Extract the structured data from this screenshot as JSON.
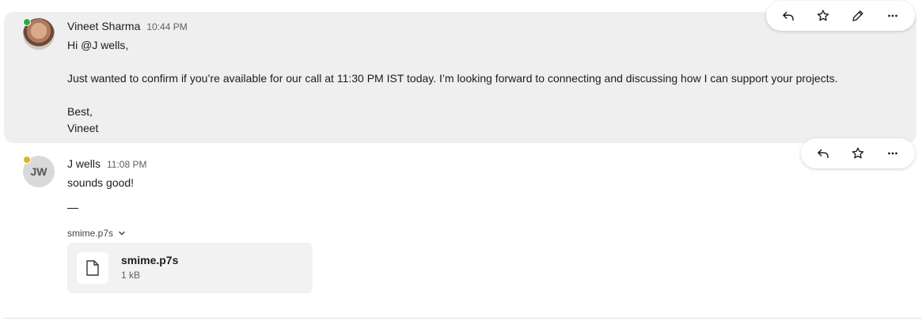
{
  "messages": [
    {
      "sender": "Vineet Sharma",
      "time": "10:44 PM",
      "lines": [
        "Hi @J wells,",
        "",
        "Just wanted to confirm if you’re available for our call at 11:30 PM IST today. I’m looking forward to connecting and discussing how I can support your projects.",
        "",
        "Best,",
        "Vineet"
      ],
      "presence": "online",
      "presence_color": "#2bac4a"
    },
    {
      "sender": "J wells",
      "initials": "JW",
      "time": "11:08 PM",
      "text": "sounds good!",
      "presence": "away",
      "presence_color": "#e0b320",
      "attachment": {
        "toggle_label": "smime.p7s",
        "name": "smime.p7s",
        "size": "1 kB",
        "icon": "file-icon"
      }
    }
  ],
  "toolbars": {
    "own_message": [
      "reply-icon",
      "star-icon",
      "edit-icon",
      "more-icon"
    ],
    "other_message": [
      "reply-icon",
      "star-icon",
      "more-icon"
    ]
  },
  "colors": {
    "highlight_bg": "#efefef",
    "online": "#2bac4a",
    "away": "#e0b320"
  }
}
